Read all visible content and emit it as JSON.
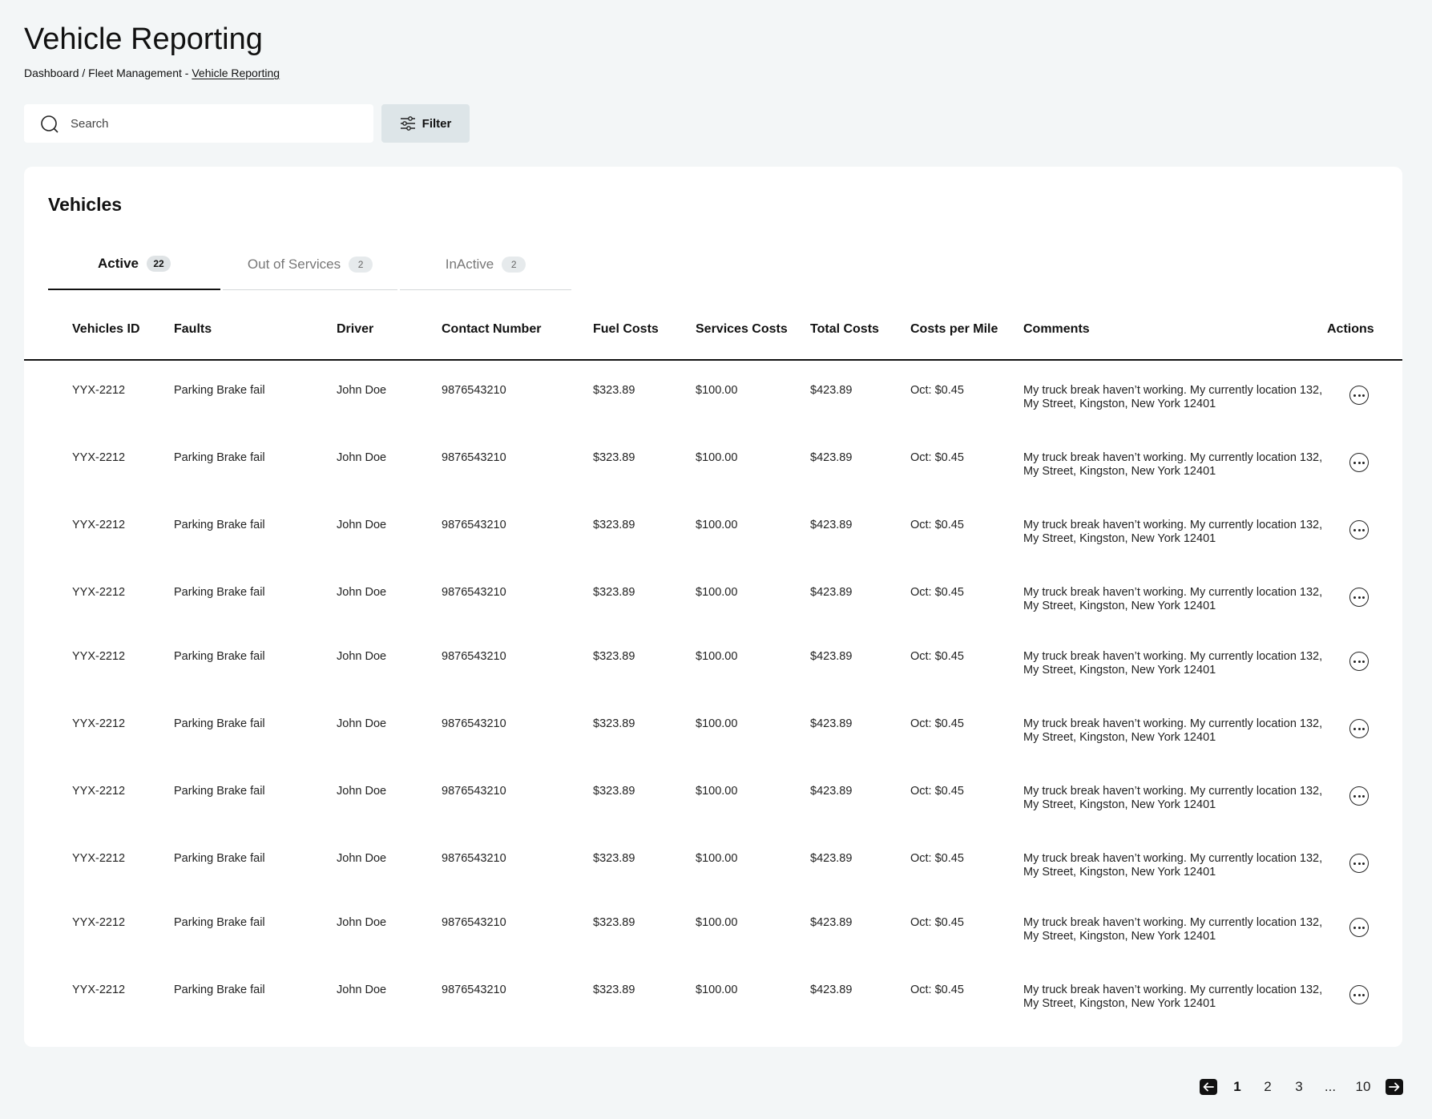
{
  "header": {
    "title": "Vehicle Reporting",
    "breadcrumb": {
      "prefix": "Dashboard / Fleet Management - ",
      "current": "Vehicle Reporting"
    }
  },
  "search": {
    "placeholder": "Search",
    "value": ""
  },
  "filter": {
    "label": "Filter"
  },
  "card": {
    "title": "Vehicles",
    "tabs": [
      {
        "label": "Active",
        "count": "22",
        "active": true
      },
      {
        "label": "Out of Services",
        "count": "2",
        "active": false
      },
      {
        "label": "InActive",
        "count": "2",
        "active": false
      }
    ]
  },
  "table": {
    "columns": [
      "Vehicles ID",
      "Faults",
      "Driver",
      "Contact Number",
      "Fuel Costs",
      "Services Costs",
      "Total Costs",
      "Costs per Mile",
      "Comments",
      "Actions"
    ],
    "rows": [
      [
        "YYX-2212",
        "Parking Brake fail",
        "John Doe",
        "9876543210",
        "$323.89",
        "$100.00",
        "$423.89",
        "Oct: $0.45",
        "My truck break haven’t working. My currently location 132, My Street, Kingston, New York 12401"
      ],
      [
        "YYX-2212",
        "Parking Brake fail",
        "John Doe",
        "9876543210",
        "$323.89",
        "$100.00",
        "$423.89",
        "Oct: $0.45",
        "My truck break haven’t working. My currently location 132, My Street, Kingston, New York 12401"
      ],
      [
        "YYX-2212",
        "Parking Brake fail",
        "John Doe",
        "9876543210",
        "$323.89",
        "$100.00",
        "$423.89",
        "Oct: $0.45",
        "My truck break haven’t working. My currently location 132, My Street, Kingston, New York 12401"
      ],
      [
        "YYX-2212",
        "Parking Brake fail",
        "John Doe",
        "9876543210",
        "$323.89",
        "$100.00",
        "$423.89",
        "Oct: $0.45",
        "My truck break haven’t working. My currently location 132, My Street, Kingston, New York 12401"
      ],
      [
        "YYX-2212",
        "Parking Brake fail",
        "John Doe",
        "9876543210",
        "$323.89",
        "$100.00",
        "$423.89",
        "Oct: $0.45",
        "My truck break haven’t working. My currently location 132, My Street, Kingston, New York 12401"
      ],
      [
        "YYX-2212",
        "Parking Brake fail",
        "John Doe",
        "9876543210",
        "$323.89",
        "$100.00",
        "$423.89",
        "Oct: $0.45",
        "My truck break haven’t working. My currently location 132, My Street, Kingston, New York 12401"
      ],
      [
        "YYX-2212",
        "Parking Brake fail",
        "John Doe",
        "9876543210",
        "$323.89",
        "$100.00",
        "$423.89",
        "Oct: $0.45",
        "My truck break haven’t working. My currently location 132, My Street, Kingston, New York 12401"
      ],
      [
        "YYX-2212",
        "Parking Brake fail",
        "John Doe",
        "9876543210",
        "$323.89",
        "$100.00",
        "$423.89",
        "Oct: $0.45",
        "My truck break haven’t working. My currently location 132, My Street, Kingston, New York 12401"
      ],
      [
        "YYX-2212",
        "Parking Brake fail",
        "John Doe",
        "9876543210",
        "$323.89",
        "$100.00",
        "$423.89",
        "Oct: $0.45",
        "My truck break haven’t working. My currently location 132, My Street, Kingston, New York 12401"
      ],
      [
        "YYX-2212",
        "Parking Brake fail",
        "John Doe",
        "9876543210",
        "$323.89",
        "$100.00",
        "$423.89",
        "Oct: $0.45",
        "My truck break haven’t working. My currently location 132, My Street, Kingston, New York 12401"
      ]
    ]
  },
  "pagination": {
    "pages": [
      "1",
      "2",
      "3",
      "...",
      "10"
    ],
    "current": "1",
    "prev_icon": "arrow-left-icon",
    "next_icon": "arrow-right-icon"
  },
  "colors": {
    "background": "#f3f6f7",
    "card": "#ffffff",
    "filter_button": "#dde5e8",
    "text": "#111111"
  }
}
